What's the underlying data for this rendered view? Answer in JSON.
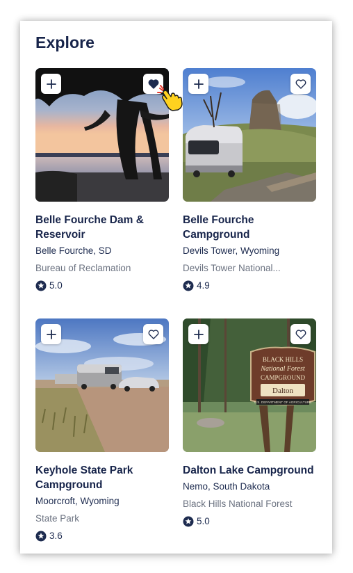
{
  "section_title": "Explore",
  "cards": [
    {
      "name": "Belle Fourche Dam & Reservoir",
      "location": "Belle Fourche, SD",
      "agency": "Bureau of Reclamation",
      "rating": "5.0",
      "favorited": true
    },
    {
      "name": "Belle Fourche Campground",
      "location": "Devils Tower, Wyoming",
      "agency": "Devils Tower National...",
      "rating": "4.9",
      "favorited": false
    },
    {
      "name": "Keyhole State Park Campground",
      "location": "Moorcroft, Wyoming",
      "agency": "State Park",
      "rating": "3.6",
      "favorited": false
    },
    {
      "name": "Dalton Lake Campground",
      "location": "Nemo, South Dakota",
      "agency": "Black Hills National Forest",
      "rating": "5.0",
      "favorited": false
    }
  ],
  "sign_text": [
    "BLACK HILLS",
    "National Forest",
    "CAMPGROUND",
    "Dalton",
    "U.S. DEPARTMENT OF AGRICULTURE"
  ],
  "icons": {
    "add": "plus-icon",
    "favorite": "heart-icon",
    "rating": "star-badge-icon",
    "pointer": "hand-pointer-icon"
  },
  "colors": {
    "text": "#17244a",
    "muted": "#6b7280"
  }
}
